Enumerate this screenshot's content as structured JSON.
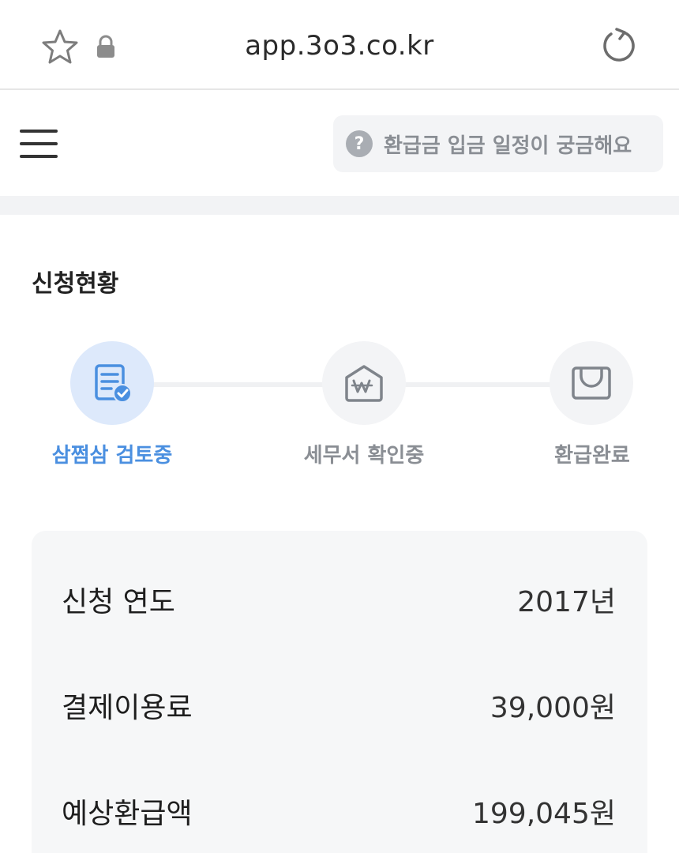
{
  "browser": {
    "url": "app.3o3.co.kr"
  },
  "header": {
    "help_label": "환급금 입금 일정이 궁금해요"
  },
  "section": {
    "title": "신청현황"
  },
  "steps": [
    {
      "label": "삼쩜삼 검토중",
      "icon": "document-check-icon",
      "active": true
    },
    {
      "label": "세무서 확인중",
      "icon": "won-house-icon",
      "active": false
    },
    {
      "label": "환급완료",
      "icon": "wallet-icon",
      "active": false
    }
  ],
  "details": [
    {
      "key": "신청 연도",
      "value": "2017년"
    },
    {
      "key": "결제이용료",
      "value": "39,000원"
    },
    {
      "key": "예상환급액",
      "value": "199,045원"
    }
  ],
  "colors": {
    "accent": "#4a8fe0",
    "accent_bg": "#dde9fb",
    "inactive": "#8a8e94",
    "card_bg": "#f6f7f8"
  }
}
